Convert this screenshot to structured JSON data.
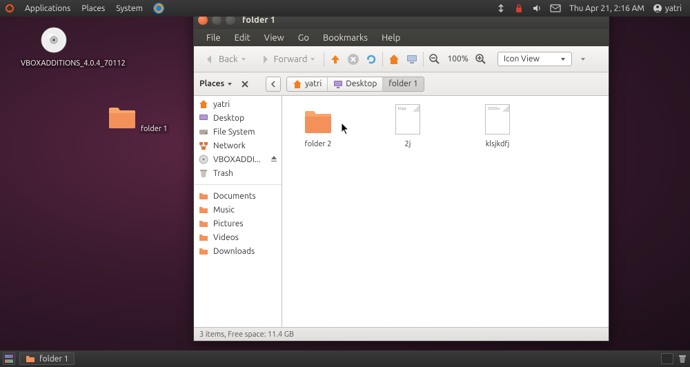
{
  "top_panel": {
    "menus": [
      "Applications",
      "Places",
      "System"
    ],
    "datetime": "Thu Apr 21,  2:16 AM",
    "username": "yatri"
  },
  "desktop": {
    "disc_label": "VBOXADDITIONS_4.0.4_70112",
    "folder_label": "folder 1"
  },
  "window": {
    "title": "folder 1",
    "menubar": [
      "File",
      "Edit",
      "View",
      "Go",
      "Bookmarks",
      "Help"
    ],
    "toolbar": {
      "back": "Back",
      "forward": "Forward",
      "zoom": "100%",
      "view_mode": "Icon View"
    },
    "pathbar": {
      "places_label": "Places",
      "crumbs": [
        {
          "label": "yatri",
          "icon": "home"
        },
        {
          "label": "Desktop",
          "icon": "desktop"
        },
        {
          "label": "folder 1",
          "icon": null
        }
      ]
    },
    "sidebar": {
      "top": [
        {
          "label": "yatri",
          "icon": "home"
        },
        {
          "label": "Desktop",
          "icon": "desktop"
        },
        {
          "label": "File System",
          "icon": "drive"
        },
        {
          "label": "Network",
          "icon": "network"
        },
        {
          "label": "VBOXADDI...",
          "icon": "disc",
          "eject": true
        },
        {
          "label": "Trash",
          "icon": "trash"
        }
      ],
      "bottom": [
        {
          "label": "Documents",
          "icon": "folder"
        },
        {
          "label": "Music",
          "icon": "folder"
        },
        {
          "label": "Pictures",
          "icon": "folder"
        },
        {
          "label": "Videos",
          "icon": "folder"
        },
        {
          "label": "Downloads",
          "icon": "folder"
        }
      ]
    },
    "content": [
      {
        "label": "folder 2",
        "type": "folder",
        "preview": ""
      },
      {
        "label": "2j",
        "type": "file",
        "preview": "klsje"
      },
      {
        "label": "klsjkdfj",
        "type": "file",
        "preview": "2039u"
      }
    ],
    "statusbar": "3 items, Free space: 11.4 GB"
  },
  "bottom_panel": {
    "task": "folder 1"
  }
}
